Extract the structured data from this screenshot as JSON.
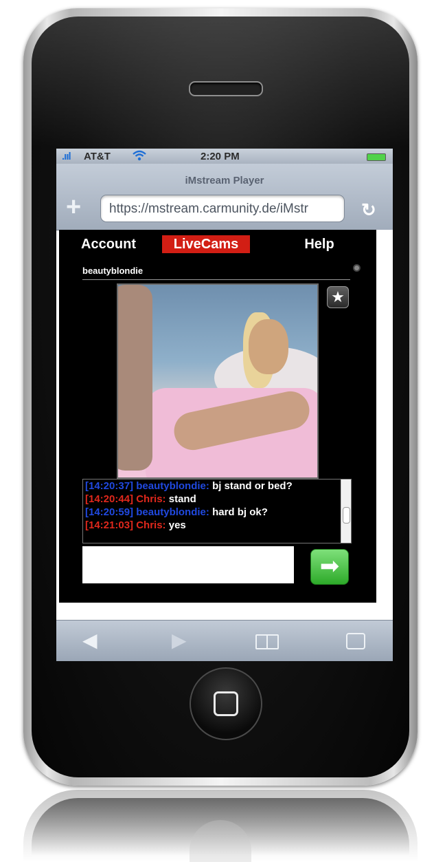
{
  "status_bar": {
    "signal": ".ııl",
    "carrier": "AT&T",
    "wifi_icon": "wifi-icon",
    "time": "2:20 PM",
    "battery_icon": "battery-icon"
  },
  "browser": {
    "page_title": "iMstream Player",
    "url": "https://mstream.carmunity.de/iMstr",
    "add_icon": "+",
    "reload_icon": "↻"
  },
  "nav": {
    "tabs": [
      {
        "label": "Account"
      },
      {
        "label": "LiveCams"
      },
      {
        "label": "Help"
      }
    ],
    "active_tab": "LiveCams"
  },
  "cam": {
    "username": "beautyblondie",
    "favorite_icon": "★"
  },
  "chat": {
    "lines": [
      {
        "time": "[14:20:37]",
        "user": "beautyblondie:",
        "message": "bj stand or bed?",
        "color": "#2049e0"
      },
      {
        "time": "[14:20:44]",
        "user": "Chris:",
        "message": "stand",
        "color": "#e0281c"
      },
      {
        "time": "[14:20:59]",
        "user": "beautyblondie:",
        "message": "hard bj ok?",
        "color": "#2049e0"
      },
      {
        "time": "[14:21:03]",
        "user": "Chris:",
        "message": "yes",
        "color": "#e0281c"
      }
    ],
    "input_value": "",
    "send_icon": "➡"
  },
  "toolbar": {
    "back_icon": "◀",
    "forward_icon": "▶"
  },
  "colors": {
    "accent_red": "#d21e14",
    "send_green": "#2eaa2a"
  }
}
